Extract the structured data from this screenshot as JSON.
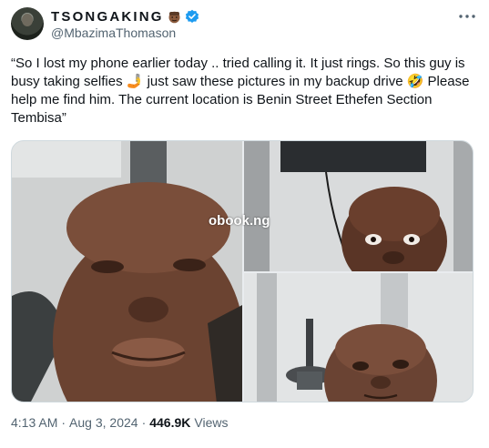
{
  "author": {
    "display_name": "TSONGAKING",
    "handle": "@MbazimaThomason",
    "emoji_badge_icon": "brown-face-emoji-icon",
    "verified_icon": "verified-badge-icon",
    "verified_color": "#1d9bf0"
  },
  "more_icon": "more-horizontal-icon",
  "tweet": {
    "text": "“So I lost my phone earlier today .. tried calling it. It just rings. So this guy is busy taking selfies 🤳 just saw these pictures in my backup drive 🤣 Please help me find him. The current location is Benin Street Ethefen Section Tembisa”"
  },
  "media": {
    "watermark": "obook.ng",
    "photos": [
      "selfie-closeup-photo",
      "selfie-peeking-photo",
      "selfie-lying-photo"
    ]
  },
  "meta": {
    "time": "4:13 AM",
    "separator": "·",
    "date": "Aug 3, 2024",
    "views_count": "446.9K",
    "views_label": "Views"
  },
  "colors": {
    "text_primary": "#0f1419",
    "text_secondary": "#536471",
    "border": "#cfd9de"
  }
}
